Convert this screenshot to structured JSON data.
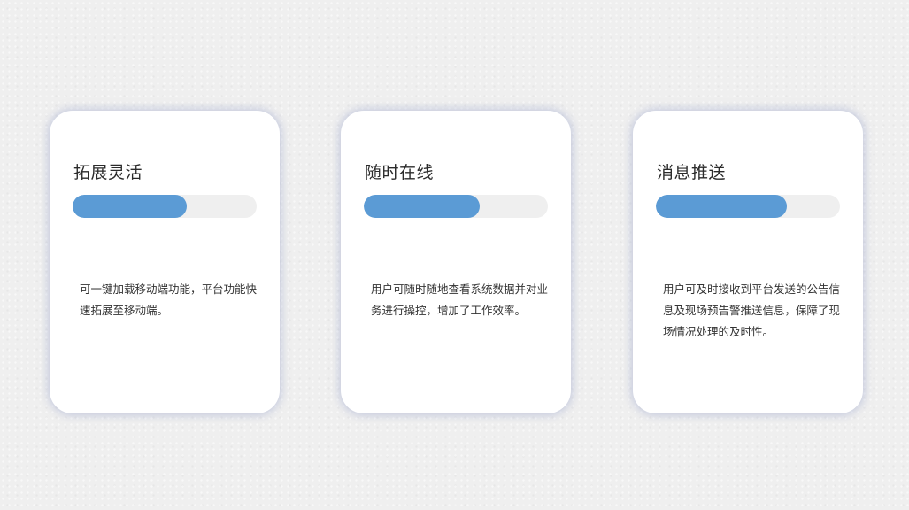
{
  "theme": {
    "accent": "#5b9bd5",
    "track": "#efefef",
    "card_bg": "#ffffff",
    "page_bg": "#efefef"
  },
  "cards": [
    {
      "title": "拓展灵活",
      "progress": 0.62,
      "description": "可一键加载移动端功能，平台功能快速拓展至移动端。"
    },
    {
      "title": "随时在线",
      "progress": 0.63,
      "description": "用户可随时随地查看系统数据并对业务进行操控，增加了工作效率。"
    },
    {
      "title": "消息推送",
      "progress": 0.71,
      "description": "用户可及时接收到平台发送的公告信息及现场预告警推送信息，保障了现场情况处理的及时性。"
    }
  ]
}
